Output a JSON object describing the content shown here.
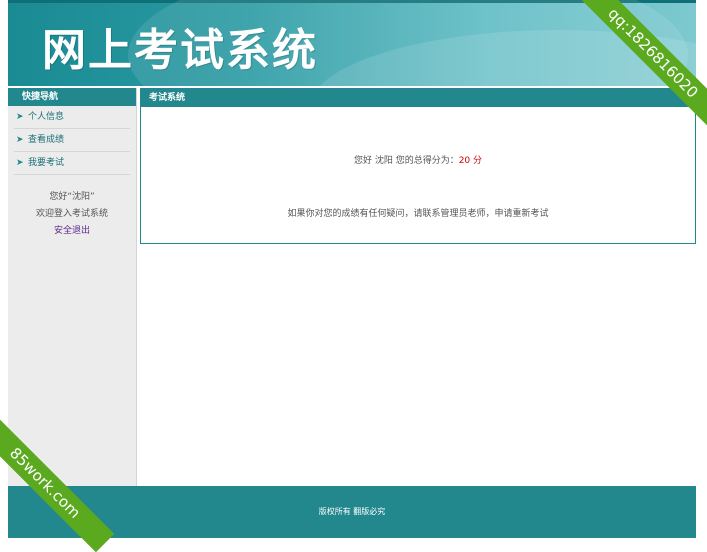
{
  "header": {
    "title": "网上考试系统"
  },
  "sidebar": {
    "title": "快捷导航",
    "items": [
      {
        "label": "个人信息"
      },
      {
        "label": "查看成绩"
      },
      {
        "label": "我要考试"
      }
    ],
    "greeting": "您好“沈阳”",
    "welcome": "欢迎登入考试系统",
    "logout": "安全退出"
  },
  "main": {
    "title": "考试系统",
    "score_prefix": "您好 沈阳 您的总得分为：",
    "score_value": "20 分",
    "notice": "如果你对您的成绩有任何疑问，请联系管理员老师，申请重新考试"
  },
  "footer": {
    "copyright": "版权所有 翻版必究"
  },
  "watermarks": {
    "top_right": "qq:1826816020",
    "bottom_left": "85work.com"
  },
  "colors": {
    "accent": "#23878e",
    "score": "#cc0000",
    "ribbon": "#5aa91f"
  }
}
